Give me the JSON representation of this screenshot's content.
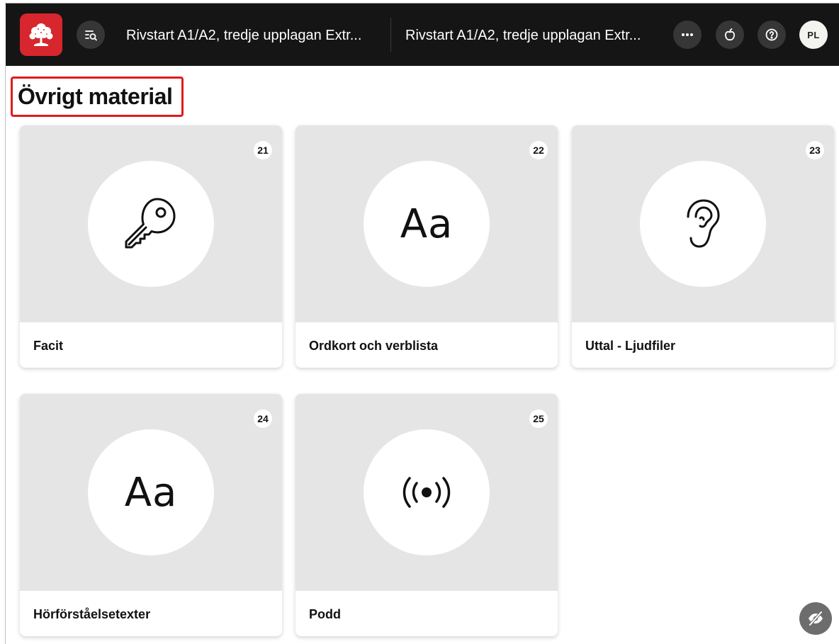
{
  "header": {
    "logo_icon": "publisher-tree-logo",
    "toc_icon": "table-of-contents-search-icon",
    "book_title_primary": "Rivstart A1/A2, tredje upplagan Extr...",
    "book_title_secondary": "Rivstart A1/A2, tredje upplagan Extr...",
    "more_icon": "more-dots-icon",
    "apple_icon": "apple-icon",
    "help_icon": "help-icon",
    "avatar_initials": "PL",
    "background_color": "#151515",
    "logo_color": "#d7262d"
  },
  "page": {
    "title": "Övrigt material",
    "highlight_color": "#e01b1b"
  },
  "cards": [
    {
      "number": "21",
      "label": "Facit",
      "icon": "key-icon"
    },
    {
      "number": "22",
      "label": "Ordkort och verblista",
      "icon": "text-aa-icon",
      "glyph": "Aa"
    },
    {
      "number": "23",
      "label": "Uttal - Ljudfiler",
      "icon": "ear-icon"
    },
    {
      "number": "24",
      "label": "Hörförståelsetexter",
      "icon": "text-aa-icon",
      "glyph": "Aa"
    },
    {
      "number": "25",
      "label": "Podd",
      "icon": "broadcast-icon"
    }
  ],
  "floating": {
    "visibility_icon": "eye-off-icon"
  }
}
